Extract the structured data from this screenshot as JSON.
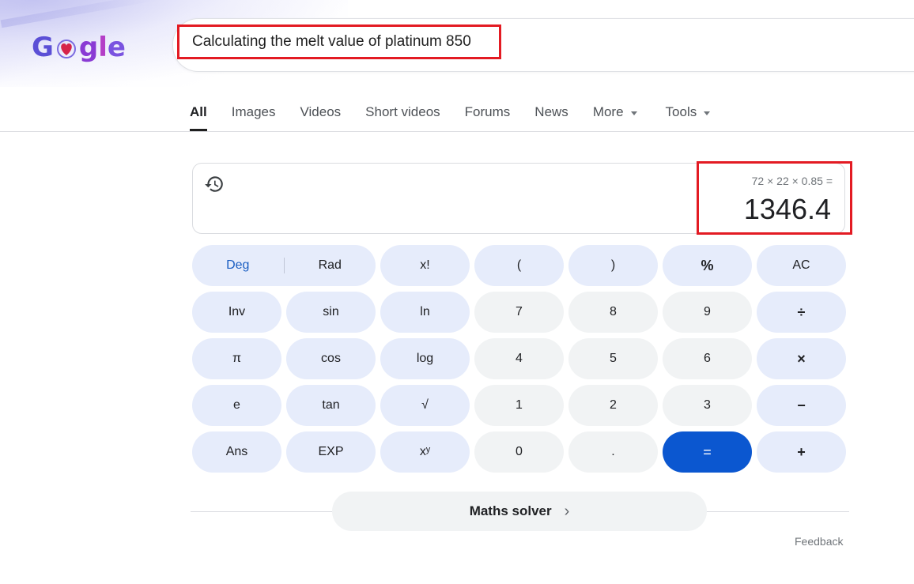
{
  "logo": {
    "chars": [
      "G",
      "",
      "g",
      "l",
      "e"
    ],
    "alt": "Google"
  },
  "search": {
    "query": "Calculating the melt value of platinum 850"
  },
  "tabs": [
    {
      "label": "All",
      "active": true
    },
    {
      "label": "Images"
    },
    {
      "label": "Videos"
    },
    {
      "label": "Short videos"
    },
    {
      "label": "Forums"
    },
    {
      "label": "News"
    },
    {
      "label": "More",
      "dropdown": true
    },
    {
      "label": "Tools",
      "dropdown": true
    }
  ],
  "calculator": {
    "expression": "72 × 22 × 0.85 =",
    "result": "1346.4",
    "deg_label": "Deg",
    "rad_label": "Rad",
    "keys": [
      [
        "x!",
        "(",
        ")",
        "%",
        "AC"
      ],
      [
        "Inv",
        "sin",
        "ln",
        "7",
        "8",
        "9",
        "÷"
      ],
      [
        "π",
        "cos",
        "log",
        "4",
        "5",
        "6",
        "×"
      ],
      [
        "e",
        "tan",
        "√",
        "1",
        "2",
        "3",
        "−"
      ],
      [
        "Ans",
        "EXP",
        "xʸ",
        "0",
        ".",
        "=",
        "+"
      ]
    ]
  },
  "maths_solver": {
    "label": "Maths solver"
  },
  "feedback": {
    "label": "Feedback"
  },
  "colors": {
    "accent_blue": "#0b57d0",
    "highlight_red": "#e31b23"
  }
}
